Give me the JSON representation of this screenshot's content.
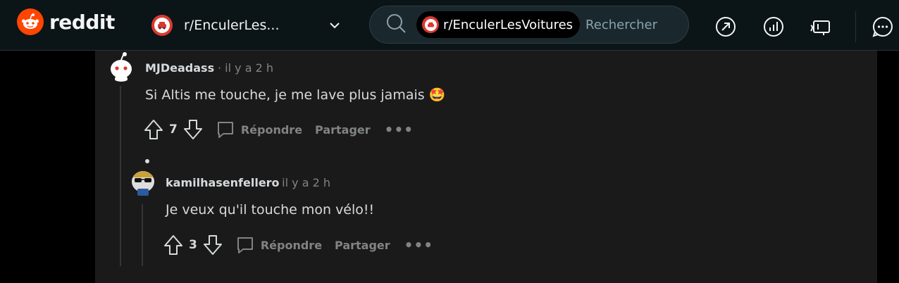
{
  "header": {
    "logo_text": "reddit",
    "community": "r/EnculerLes...",
    "search_chip": "r/EnculerLesVoitures",
    "search_placeholder": "Rechercher",
    "icons": [
      "popular-icon",
      "stats-icon",
      "advertise-icon",
      "chat-icon",
      "notifications-icon"
    ]
  },
  "comments": [
    {
      "author": "MJDeadass",
      "time": "il y a 2 h",
      "body": "Si Altis me touche, je me lave plus jamais 🤩",
      "score": "7",
      "reply_label": "Répondre",
      "share_label": "Partager",
      "more_label": "•••"
    },
    {
      "author": "kamilhasenfellero",
      "time": "il y a 2 h",
      "body": "Je veux qu'il touche mon vélo!!",
      "score": "3",
      "reply_label": "Répondre",
      "share_label": "Partager",
      "more_label": "•••"
    }
  ],
  "colors": {
    "brand": "#ff4500",
    "background": "#0b1416",
    "comment_bg": "#1a1a1b",
    "muted": "#818384"
  }
}
